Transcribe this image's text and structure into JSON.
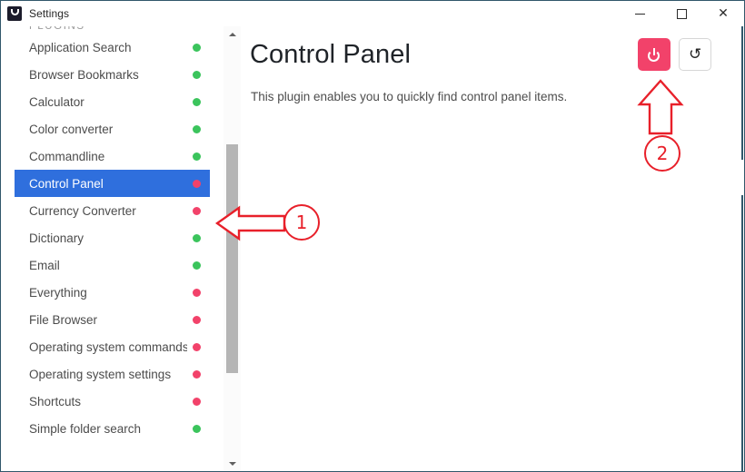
{
  "window": {
    "title": "Settings",
    "app_icon": "flow-launcher-icon",
    "controls": {
      "minimize": "minimize-icon",
      "maximize": "maximize-icon",
      "close": "close-icon"
    }
  },
  "sidebar": {
    "section_header": "PLUGINS",
    "selected_index": 5,
    "items": [
      {
        "label": "Application Search",
        "status": "enabled",
        "color": "#3bc45c"
      },
      {
        "label": "Browser Bookmarks",
        "status": "enabled",
        "color": "#3bc45c"
      },
      {
        "label": "Calculator",
        "status": "enabled",
        "color": "#3bc45c"
      },
      {
        "label": "Color converter",
        "status": "enabled",
        "color": "#3bc45c"
      },
      {
        "label": "Commandline",
        "status": "enabled",
        "color": "#3bc45c"
      },
      {
        "label": "Control Panel",
        "status": "disabled",
        "color": "#f2426a"
      },
      {
        "label": "Currency Converter",
        "status": "disabled",
        "color": "#f2426a"
      },
      {
        "label": "Dictionary",
        "status": "enabled",
        "color": "#3bc45c"
      },
      {
        "label": "Email",
        "status": "enabled",
        "color": "#3bc45c"
      },
      {
        "label": "Everything",
        "status": "disabled",
        "color": "#f2426a"
      },
      {
        "label": "File Browser",
        "status": "disabled",
        "color": "#f2426a"
      },
      {
        "label": "Operating system commands",
        "status": "disabled",
        "color": "#f2426a"
      },
      {
        "label": "Operating system settings",
        "status": "disabled",
        "color": "#f2426a"
      },
      {
        "label": "Shortcuts",
        "status": "disabled",
        "color": "#f2426a"
      },
      {
        "label": "Simple folder search",
        "status": "enabled",
        "color": "#3bc45c"
      }
    ],
    "scrollbar": {
      "up_arrow": "scroll-up-icon",
      "down_arrow": "scroll-down-icon"
    }
  },
  "content": {
    "title": "Control Panel",
    "description": "This plugin enables you to quickly find control panel items.",
    "actions": [
      {
        "name": "power-toggle-button",
        "icon": "power-icon",
        "color": "#f2426a",
        "state": "disabled"
      },
      {
        "name": "reset-button",
        "icon": "reset-icon",
        "glyph": "↺",
        "color": "#ffffff"
      }
    ]
  },
  "annotations": [
    {
      "id": "1",
      "label": "①",
      "arrow": "left-arrow",
      "color": "#e8202a",
      "points_to": "Control Panel"
    },
    {
      "id": "2",
      "label": "②",
      "arrow": "up-arrow",
      "color": "#e8202a",
      "points_to": "power-toggle-button"
    }
  ]
}
